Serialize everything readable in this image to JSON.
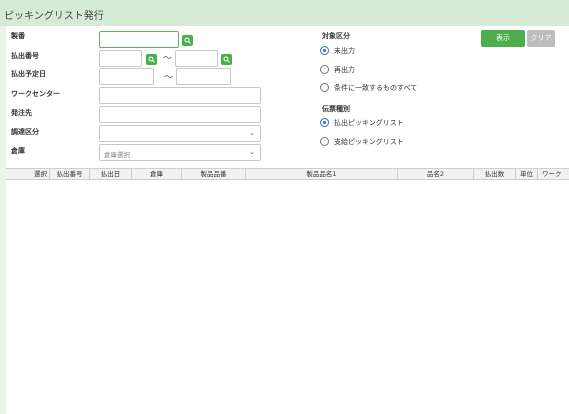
{
  "title": "ピッキングリスト発行",
  "form": {
    "product_no_label": "製番",
    "shipment_no_label": "払出番号",
    "shipment_date_label": "払出予定日",
    "work_center_label": "ワークセンター",
    "order_dest_label": "発注先",
    "procurement_label": "調達区分",
    "warehouse_label": "倉庫",
    "warehouse_placeholder": "倉庫選択",
    "tilde": "〜"
  },
  "target": {
    "label": "対象区分",
    "options": [
      "未出力",
      "再出力",
      "条件に一致するものすべて"
    ],
    "selected": 0
  },
  "slip": {
    "label": "伝票種別",
    "options": [
      "払出ピッキングリスト",
      "支給ピッキングリスト"
    ],
    "selected": 0
  },
  "buttons": {
    "show": "表示",
    "clear": "クリア"
  },
  "grid": {
    "columns": [
      "選択",
      "払出番号",
      "払出日",
      "倉庫",
      "製品品番",
      "製品品名1",
      "品名2",
      "払出数",
      "単位",
      "ワーク"
    ]
  },
  "colors": {
    "accent": "#4cae4c",
    "title_bg": "#d6ebd6",
    "radio_selected": "#2b6cd4"
  }
}
